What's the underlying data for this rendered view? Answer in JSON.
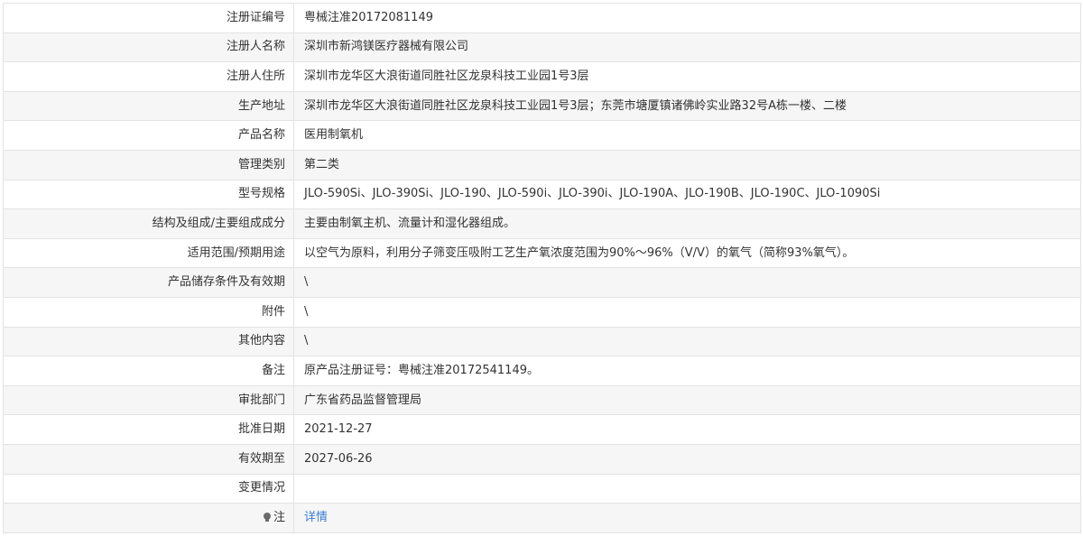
{
  "rows": [
    {
      "label": "注册证编号",
      "value": "粤械注准20172081149"
    },
    {
      "label": "注册人名称",
      "value": "深圳市新鸿镁医疗器械有限公司"
    },
    {
      "label": "注册人住所",
      "value": "深圳市龙华区大浪街道同胜社区龙泉科技工业园1号3层"
    },
    {
      "label": "生产地址",
      "value": "深圳市龙华区大浪街道同胜社区龙泉科技工业园1号3层；东莞市塘厦镇诸佛岭实业路32号A栋一楼、二楼"
    },
    {
      "label": "产品名称",
      "value": "医用制氧机"
    },
    {
      "label": "管理类别",
      "value": "第二类"
    },
    {
      "label": "型号规格",
      "value": "JLO-590Si、JLO-390Si、JLO-190、JLO-590i、JLO-390i、JLO-190A、JLO-190B、JLO-190C、JLO-1090Si"
    },
    {
      "label": "结构及组成/主要组成成分",
      "value": "主要由制氧主机、流量计和湿化器组成。"
    },
    {
      "label": "适用范围/预期用途",
      "value": "以空气为原料，利用分子筛变压吸附工艺生产氧浓度范围为90%～96%（V/V）的氧气（简称93%氧气）。"
    },
    {
      "label": "产品储存条件及有效期",
      "value": "\\"
    },
    {
      "label": "附件",
      "value": "\\"
    },
    {
      "label": "其他内容",
      "value": "\\"
    },
    {
      "label": "备注",
      "value": "原产品注册证号：粤械注准20172541149。"
    },
    {
      "label": "审批部门",
      "value": "广东省药品监督管理局"
    },
    {
      "label": "批准日期",
      "value": "2021-12-27"
    },
    {
      "label": "有效期至",
      "value": "2027-06-26"
    },
    {
      "label": "变更情况",
      "value": ""
    }
  ],
  "note": {
    "icon": "bulb-icon",
    "label": "注",
    "link_text": "详情"
  },
  "colors": {
    "border": "#e3e3e3",
    "stripe": "#f6f6f6",
    "text": "#333333",
    "link": "#3a7bd5"
  }
}
